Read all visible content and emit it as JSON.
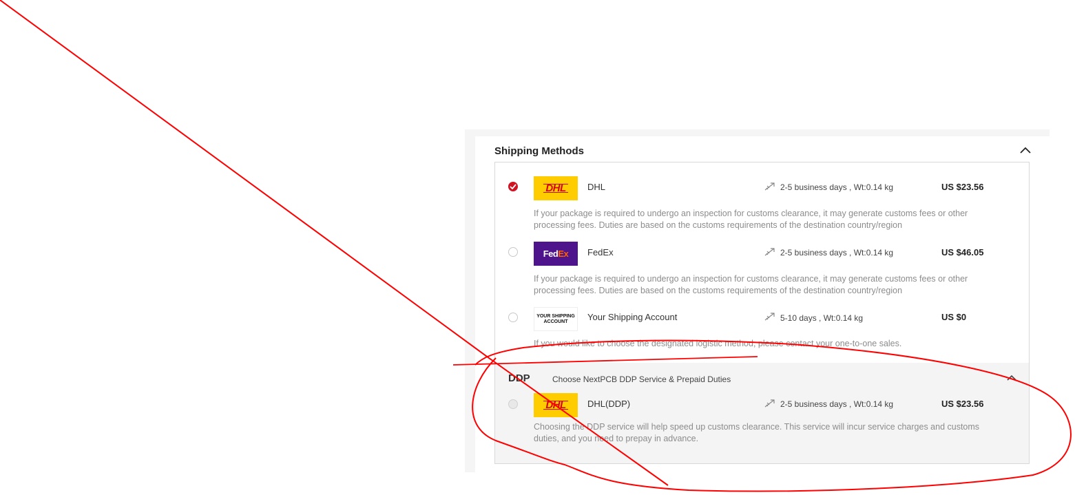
{
  "section": {
    "title": "Shipping Methods"
  },
  "methods": [
    {
      "name": "DHL",
      "logo_text": "DHL",
      "transit": "2-5 business days , Wt:0.14 kg",
      "price": "US $23.56",
      "selected": true,
      "description_line1": "If your package is required to undergo an inspection for customs clearance, it may generate customs fees or other",
      "description_line2": "processing fees. Duties are based on the customs requirements of the destination country/region"
    },
    {
      "name": "FedEx",
      "logo_text_fed": "Fed",
      "logo_text_ex": "Ex",
      "transit": "2-5 business days , Wt:0.14 kg",
      "price": "US $46.05",
      "selected": false,
      "description_line1": "If your package is required to undergo an inspection for customs clearance, it may generate customs fees or other",
      "description_line2": "processing fees. Duties are based on the customs requirements of the destination country/region"
    },
    {
      "name": "Your Shipping Account",
      "logo_text_line1": "YOUR SHIPPING",
      "logo_text_line2": "ACCOUNT",
      "transit": "5-10 days , Wt:0.14 kg",
      "price": "US $0",
      "selected": false,
      "description_line1": "If you would like to choose the designated logistic method, please contact your one-to-one sales."
    }
  ],
  "ddp": {
    "title": "DDP",
    "subtitle": "Choose NextPCB DDP Service & Prepaid Duties",
    "method": {
      "name": "DHL(DDP)",
      "logo_text": "DHL",
      "transit": "2-5 business days , Wt:0.14 kg",
      "price": "US $23.56",
      "description_line1": "Choosing the DDP service will help speed up customs clearance. This service will incur service charges and customs",
      "description_line2": "duties, and you need to prepay in advance."
    }
  },
  "colors": {
    "accent_red": "#cf1322",
    "dhl_yellow": "#ffcc00",
    "dhl_red": "#d40511",
    "fedex_purple": "#4d148c",
    "fedex_orange": "#ff6200",
    "annotation_red": "#ff0000"
  },
  "icons": {
    "collapse": "chevron-up-icon",
    "transit": "plane-icon",
    "check": "check-icon"
  }
}
